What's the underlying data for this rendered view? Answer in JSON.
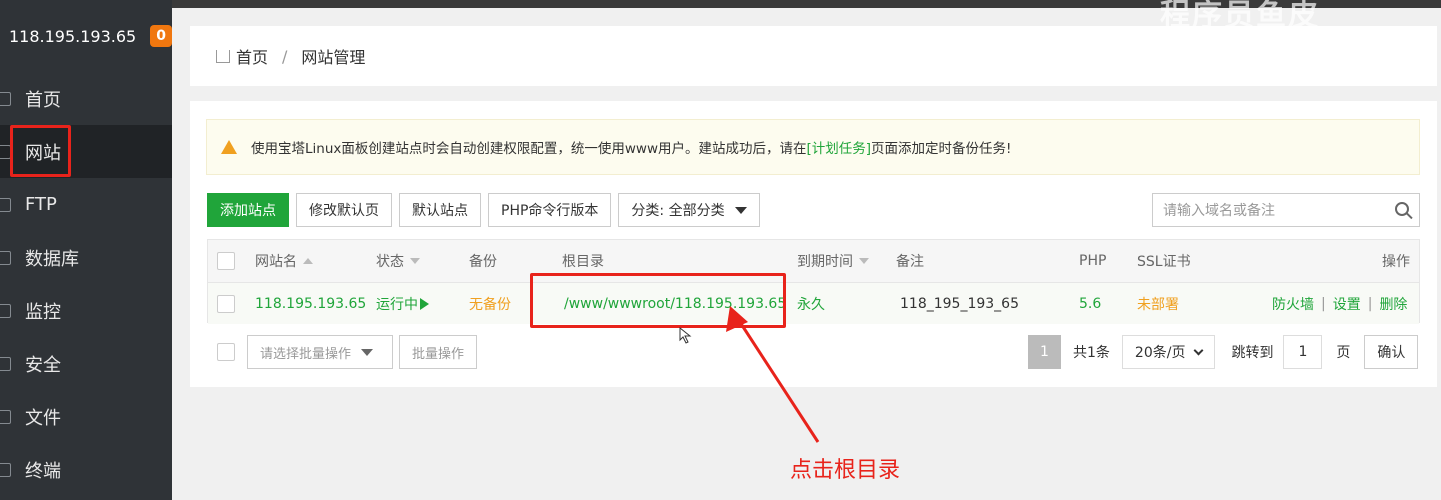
{
  "sidebar": {
    "server_ip": "118.195.193.65",
    "badge": "0",
    "items": [
      {
        "label": "首页",
        "icon": "home-icon"
      },
      {
        "label": "网站",
        "icon": "globe-icon"
      },
      {
        "label": "FTP",
        "icon": "ftp-icon"
      },
      {
        "label": "数据库",
        "icon": "database-icon"
      },
      {
        "label": "监控",
        "icon": "monitor-icon"
      },
      {
        "label": "安全",
        "icon": "shield-icon"
      },
      {
        "label": "文件",
        "icon": "folder-icon"
      },
      {
        "label": "终端",
        "icon": "terminal-icon"
      }
    ]
  },
  "watermark": "程序员鱼皮",
  "breadcrumb": {
    "home": "首页",
    "sep": "/",
    "current": "网站管理"
  },
  "notice": {
    "before": "使用宝塔Linux面板创建站点时会自动创建权限配置，统一使用www用户。建站成功后，请在",
    "link": "[计划任务]",
    "after": "页面添加定时备份任务!"
  },
  "toolbar": {
    "add_site": "添加站点",
    "edit_default": "修改默认页",
    "default_site": "默认站点",
    "php_cli": "PHP命令行版本",
    "category": "分类: 全部分类"
  },
  "search": {
    "placeholder": "请输入域名或备注"
  },
  "table": {
    "headers": {
      "name": "网站名",
      "status": "状态",
      "backup": "备份",
      "root": "根目录",
      "expire": "到期时间",
      "remark": "备注",
      "php": "PHP",
      "ssl": "SSL证书",
      "ops": "操作"
    },
    "rows": [
      {
        "name": "118.195.193.65",
        "status": "运行中",
        "backup": "无备份",
        "root": "/www/wwwroot/118.195.193.65",
        "expire": "永久",
        "remark": "118_195_193_65",
        "php": "5.6",
        "ssl": "未部署",
        "ops": [
          "防火墙",
          "设置",
          "删除"
        ]
      }
    ]
  },
  "footer": {
    "batch_placeholder": "请选择批量操作",
    "batch_button": "批量操作",
    "page": "1",
    "total": "共1条",
    "page_size": "20条/页",
    "jump_label": "跳转到",
    "jump_value": "1",
    "page_unit": "页",
    "confirm": "确认"
  },
  "annotation": "点击根目录",
  "colors": {
    "accent": "#20a53a",
    "warning": "#f0a020",
    "highlight": "#e8231b",
    "sidebar": "#2f3337"
  }
}
